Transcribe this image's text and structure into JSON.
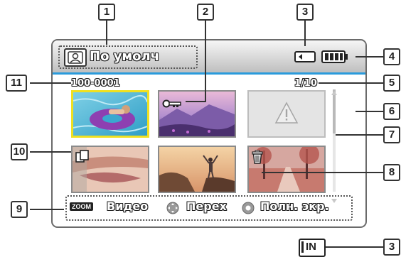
{
  "header": {
    "mode_label": "По умолч",
    "icons": [
      "default-mode-icon",
      "storage-memory-card-icon",
      "battery-full-icon"
    ]
  },
  "file_number": "100-0001",
  "page_counter": "1/10",
  "bottom_bar": {
    "zoom_badge": "ZOOM",
    "zoom_action": "Видео",
    "nav_action": "Перех",
    "ok_action": "Полн. экр."
  },
  "callouts": [
    "1",
    "2",
    "3",
    "4",
    "5",
    "6",
    "7",
    "8",
    "9",
    "10",
    "11",
    "3"
  ],
  "below_icon": {
    "label": "IN",
    "icon": "internal-memory-icon"
  },
  "thumbnails": [
    {
      "name": "pool-float",
      "icon": null,
      "selected": true
    },
    {
      "name": "mountain-flowers",
      "icon": "protect-key-icon",
      "selected": false
    },
    {
      "name": "error-file",
      "icon": "warning-icon",
      "selected": false
    },
    {
      "name": "face-closeup",
      "icon": "copy-icon",
      "selected": false
    },
    {
      "name": "hiker-cliff",
      "icon": null,
      "selected": false
    },
    {
      "name": "autumn-path",
      "icon": "delete-trash-icon",
      "selected": false
    }
  ],
  "colors": {
    "accent_line": "#2a9bdc",
    "selected_border": "#f0e020"
  }
}
